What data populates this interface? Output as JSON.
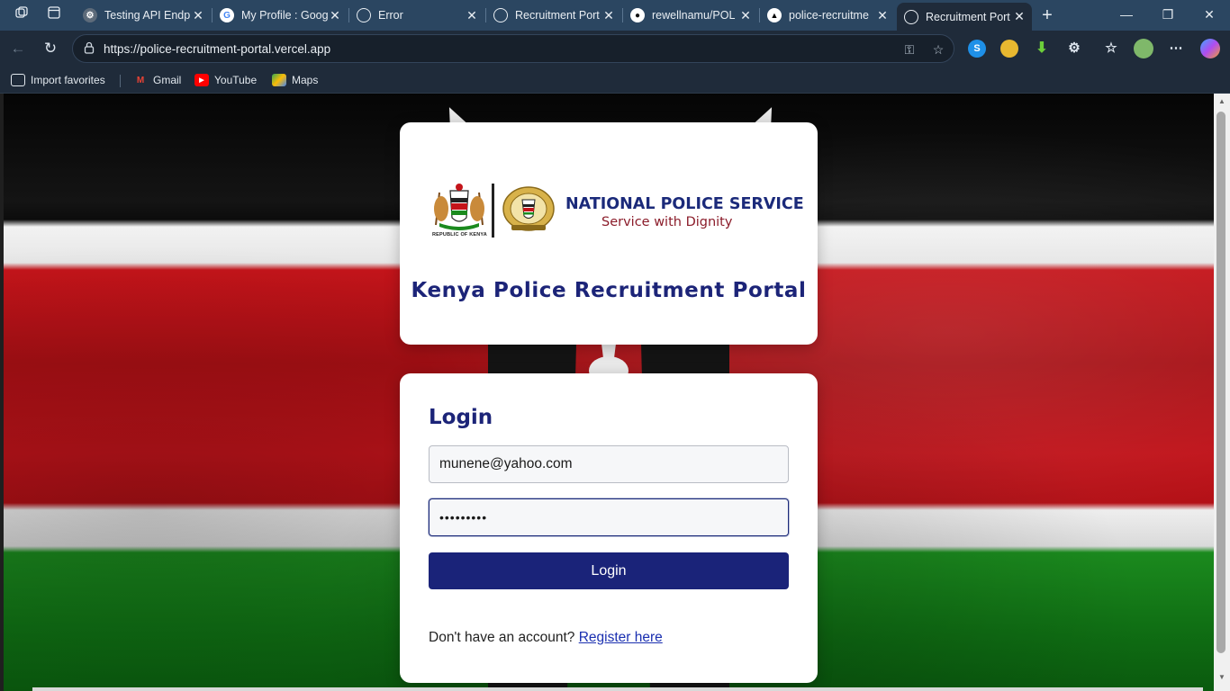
{
  "browser": {
    "tabs": [
      {
        "title": "Testing API Endp",
        "favicon": "gear-icon"
      },
      {
        "title": "My Profile : Goog",
        "favicon": "google-icon"
      },
      {
        "title": "Error",
        "favicon": "globe-icon"
      },
      {
        "title": "Recruitment Port",
        "favicon": "globe-icon"
      },
      {
        "title": "rewellnamu/POL",
        "favicon": "github-icon"
      },
      {
        "title": "police-recruitme",
        "favicon": "vercel-icon"
      },
      {
        "title": "Recruitment Port",
        "favicon": "globe-icon",
        "active": true
      }
    ],
    "url": "https://police-recruitment-portal.vercel.app",
    "favorites": [
      {
        "label": "Import favorites",
        "icon": "import-icon"
      },
      {
        "label": "Gmail",
        "icon": "gmail-icon"
      },
      {
        "label": "YouTube",
        "icon": "youtube-icon"
      },
      {
        "label": "Maps",
        "icon": "maps-icon"
      }
    ]
  },
  "header_card": {
    "logo_title": "NATIONAL POLICE SERVICE",
    "logo_subtitle": "Service with Dignity",
    "coat_of_arms_caption": "REPUBLIC OF KENYA",
    "portal_title": "Kenya Police Recruitment Portal"
  },
  "login": {
    "heading": "Login",
    "email_value": "munene@yahoo.com",
    "password_value": "•••••••••",
    "button_label": "Login",
    "register_prompt": "Don't have an account?",
    "register_link": "Register here"
  },
  "colors": {
    "primary": "#1a2379",
    "tabbar": "#2b4661",
    "toolbar": "#1f2b3a",
    "subtitle": "#8b1c2a"
  }
}
